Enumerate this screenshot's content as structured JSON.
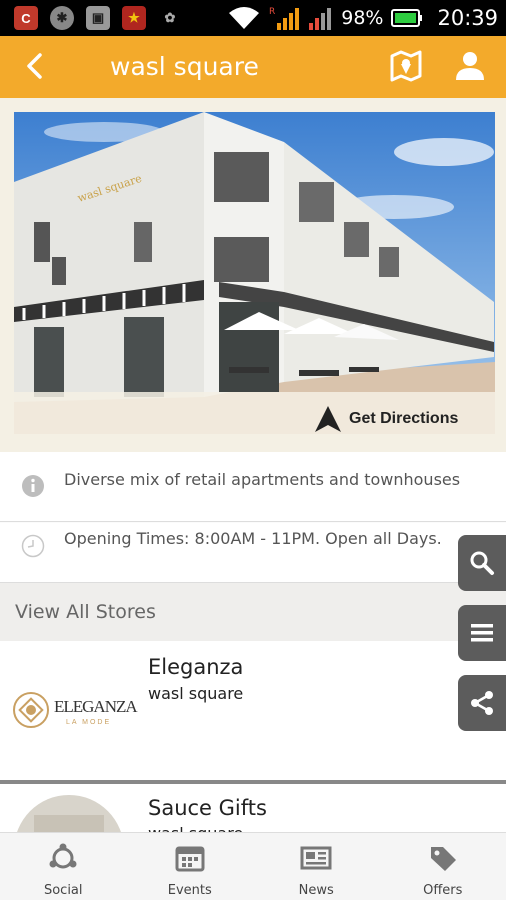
{
  "status_bar": {
    "battery_percent": "98%",
    "time": "20:39",
    "network_label": "R"
  },
  "app_bar": {
    "title": "wasl square"
  },
  "hero": {
    "directions_label": "Get Directions"
  },
  "info": {
    "description": "Diverse mix of retail apartments and townhouses",
    "opening_times": "Opening Times: 8:00AM - 11PM. Open all Days."
  },
  "stores_header": "View All Stores",
  "stores": [
    {
      "name": "Eleganza",
      "location": "wasl square",
      "logo_text": "ELEGANZA",
      "logo_sub": "LA MODE"
    },
    {
      "name": "Sauce Gifts",
      "location": "wasl square"
    }
  ],
  "bottom_nav": [
    {
      "label": "Social",
      "icon": "social-icon"
    },
    {
      "label": "Events",
      "icon": "calendar-icon"
    },
    {
      "label": "News",
      "icon": "newspaper-icon"
    },
    {
      "label": "Offers",
      "icon": "tag-icon"
    }
  ],
  "colors": {
    "accent": "#f3aa2b",
    "fab": "#5c5c5c",
    "statusbar": "#000000"
  }
}
